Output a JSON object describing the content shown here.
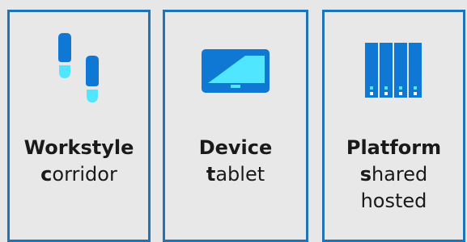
{
  "cards": [
    {
      "title": "Workstyle",
      "lines": [
        {
          "initial": "c",
          "rest": "orridor"
        }
      ],
      "icon": "footprints-icon"
    },
    {
      "title": "Device",
      "lines": [
        {
          "initial": "t",
          "rest": "ablet"
        }
      ],
      "icon": "tablet-icon"
    },
    {
      "title": "Platform",
      "lines": [
        {
          "initial": "s",
          "rest": "hared"
        },
        {
          "initial": "",
          "rest": "hosted"
        }
      ],
      "icon": "server-rack-icon"
    }
  ],
  "colors": {
    "border": "#1f74b8",
    "icon_dark": "#0f78d4",
    "icon_light": "#50e6ff",
    "background": "#e7e7e7"
  }
}
